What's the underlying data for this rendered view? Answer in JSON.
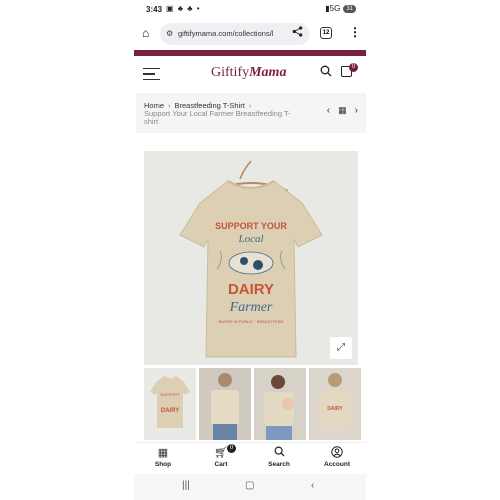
{
  "status": {
    "time": "3:43",
    "notif_icons": "▣ ♣ ♣ •",
    "signal": "⁵ᴳ 5G",
    "battery": "31"
  },
  "browser": {
    "url": "giftifymama.com/collections/l",
    "tab_count": "12"
  },
  "site": {
    "logo_prefix": "Giftify",
    "logo_suffix": "Mama",
    "cart_count": "0"
  },
  "breadcrumb": {
    "home": "Home",
    "category": "Breastfeeding T-Shirt",
    "current": "Support Your Local Farmer Breastfeeding T-shirt"
  },
  "shirt_art": {
    "line1": "SUPPORT YOUR",
    "line2": "Local",
    "line3": "DAIRY",
    "line4": "Farmer",
    "arc_text": "NURSE IN PUBLIC · BREASTFEED"
  },
  "bottom_nav": {
    "shop": "Shop",
    "cart": "Cart",
    "cart_count": "0",
    "search": "Search",
    "account": "Account"
  },
  "colors": {
    "brand": "#7a1f3d",
    "shirt": "#dccfb4",
    "text_red": "#c7543a",
    "text_blue": "#3c6a8c"
  }
}
